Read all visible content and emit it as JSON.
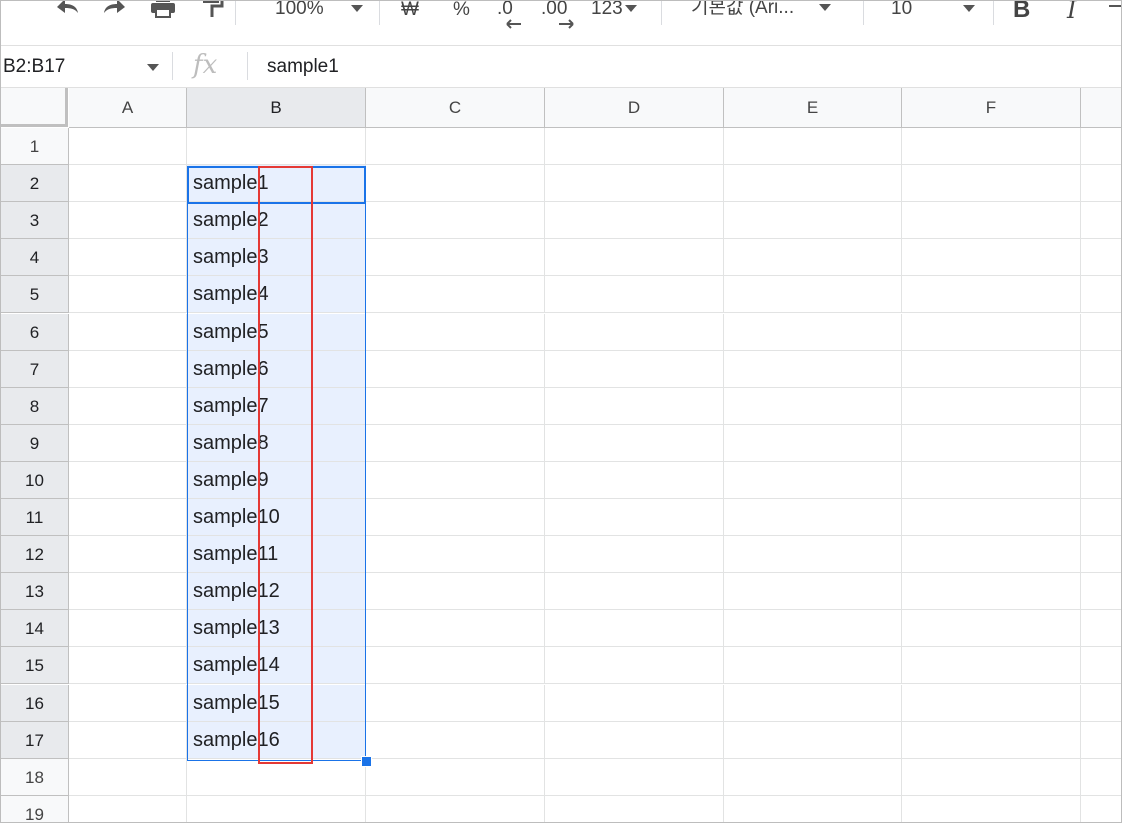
{
  "toolbar": {
    "zoom": "100%",
    "currency": "₩",
    "percent": "%",
    "decimal_decrease": ".0",
    "decimal_increase": ".00",
    "number_format": "123",
    "font": "기본값 (Ari...",
    "font_size": "10",
    "bold": "B",
    "italic": "I"
  },
  "formula_bar": {
    "name_box": "B2:B17",
    "fx": "fx",
    "content": "sample1"
  },
  "columns": [
    "A",
    "B",
    "C",
    "D",
    "E",
    "F"
  ],
  "rows": [
    "1",
    "2",
    "3",
    "4",
    "5",
    "6",
    "7",
    "8",
    "9",
    "10",
    "11",
    "12",
    "13",
    "14",
    "15",
    "16",
    "17",
    "18",
    "19"
  ],
  "cells_b": [
    "",
    "sample1",
    "sample2",
    "sample3",
    "sample4",
    "sample5",
    "sample6",
    "sample7",
    "sample8",
    "sample9",
    "sample10",
    "sample11",
    "sample12",
    "sample13",
    "sample14",
    "sample15",
    "sample16",
    "",
    ""
  ],
  "colors": {
    "selection_border": "#1a73e8",
    "selection_fill": "#e8f0fe",
    "annotation_box": "#e53935"
  }
}
